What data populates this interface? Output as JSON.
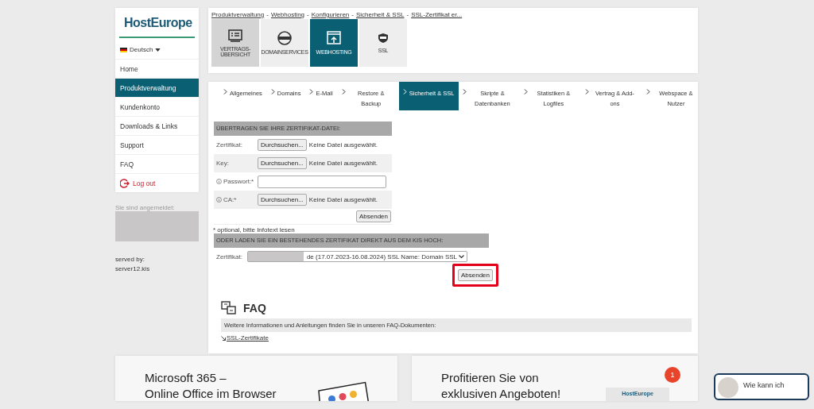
{
  "sidebar": {
    "logo": "HostEurope",
    "language": "Deutsch",
    "nav": [
      {
        "label": "Home",
        "selected": false
      },
      {
        "label": "Produktverwaltung",
        "selected": true
      },
      {
        "label": "Kundenkonto",
        "selected": false
      },
      {
        "label": "Downloads & Links",
        "selected": false
      },
      {
        "label": "Support",
        "selected": false
      },
      {
        "label": "FAQ",
        "selected": false
      }
    ],
    "logout": "Log out",
    "login_label": "Sie sind angemeldet:",
    "served_by_label": "served by:",
    "server": "server12.kis"
  },
  "breadcrumbs": {
    "separator": "-",
    "items": [
      "Produktverwaltung",
      "Webhosting",
      "Konfigurieren",
      "Sicherheit & SSL",
      "SSL-Zertifikat er..."
    ]
  },
  "product_tabs": [
    {
      "kind": "contract",
      "label": "VERTRAGS-ÜBERSICHT",
      "selected": false
    },
    {
      "kind": "domain",
      "label": "DOMAINSERVICES",
      "selected": false
    },
    {
      "kind": "hosting",
      "label": "WEBHOSTING",
      "selected": true
    },
    {
      "kind": "ssl",
      "label": "SSL",
      "selected": false
    }
  ],
  "section_tabs": [
    {
      "label": "Allgemeines",
      "selected": false
    },
    {
      "label": "Domains",
      "selected": false
    },
    {
      "label": "E-Mail",
      "selected": false
    },
    {
      "label": "Restore & Backup",
      "selected": false
    },
    {
      "label": "Sicherheit & SSL",
      "selected": true
    },
    {
      "label": "Skripte & Datenbanken",
      "selected": false
    },
    {
      "label": "Statistiken & Logfiles",
      "selected": false
    },
    {
      "label": "Vertrag & Add-ons",
      "selected": false
    },
    {
      "label": "Webspace & Nutzer",
      "selected": false
    }
  ],
  "upload_form": {
    "heading": "ÜBERTRAGEN SIE IHRE ZERTIFIKAT-DATEI:",
    "rows": [
      {
        "kind": "file",
        "label": "Zertifikat:",
        "info": false,
        "button": "Durchsuchen...",
        "status": "Keine Datei ausgewählt."
      },
      {
        "kind": "file",
        "label": "Key:",
        "info": false,
        "button": "Durchsuchen...",
        "status": "Keine Datei ausgewählt."
      },
      {
        "kind": "password",
        "label": "Passwort:*",
        "info": true
      },
      {
        "kind": "file",
        "label": "CA:*",
        "info": true,
        "button": "Durchsuchen...",
        "status": "Keine Datei ausgewählt."
      }
    ],
    "submit": "Absenden",
    "footnote": "* optional, bitte Infotext lesen"
  },
  "kis_form": {
    "heading": "ODER LADEN SIE EIN BESTEHENDES ZERTIFIKAT DIREKT AUS DEM KIS HOCH:",
    "label": "Zertifikat:",
    "select_value": "de (17.07.2023-16.08.2024) SSL Name: Domain SSL",
    "submit": "Absenden",
    "highlighted": true
  },
  "faq": {
    "title": "FAQ",
    "text": "Weitere Informationen und Anleitungen finden Sie in unseren FAQ-Dokumenten:",
    "link": "SSL-Zertifikate"
  },
  "promos": [
    {
      "kind": "office",
      "lines": [
        "Microsoft 365 –",
        "Online Office im Browser"
      ]
    },
    {
      "kind": "offer",
      "lines": [
        "Profitieren Sie von",
        "exklusiven Angeboten!"
      ],
      "badge": "1",
      "logo": "HostEurope"
    }
  ],
  "chat": {
    "text": "Wie kann ich"
  }
}
